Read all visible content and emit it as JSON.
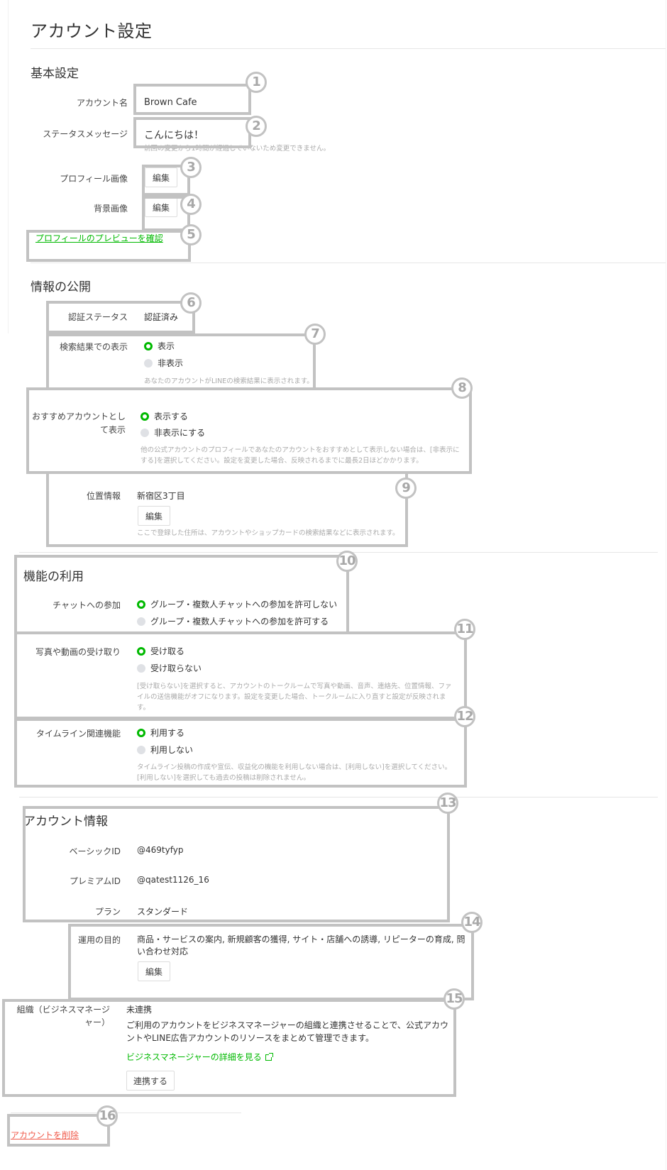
{
  "page": {
    "title": "アカウント設定"
  },
  "basic": {
    "title": "基本設定",
    "account_name_label": "アカウント名",
    "account_name_value": "Brown Cafe",
    "status_label": "ステータスメッセージ",
    "status_value": "こんにちは！",
    "status_help": "前回の変更から1時間が経過していないため変更できません。",
    "profile_image_label": "プロフィール画像",
    "background_image_label": "背景画像",
    "edit_label": "編集",
    "preview_link": "プロフィールのプレビューを確認"
  },
  "disclosure": {
    "title": "情報の公開",
    "verify_label": "認証ステータス",
    "verify_value": "認証済み",
    "search_label": "検索結果での表示",
    "search_options": [
      "表示",
      "非表示"
    ],
    "search_selected": 0,
    "search_help": "あなたのアカウントがLINEの検索結果に表示されます。",
    "recommend_label_1": "おすすめアカウントとし",
    "recommend_label_2": "て表示",
    "recommend_options": [
      "表示する",
      "非表示にする"
    ],
    "recommend_selected": 0,
    "recommend_help_1": "他の公式アカウントのプロフィールであなたのアカウントをおすすめとして表示しない場合は、[非表示に",
    "recommend_help_2": "する]を選択してください。設定を変更した場合、反映されるまでに最長2日ほどかかります。",
    "location_label": "位置情報",
    "location_value": "新宿区3丁目",
    "location_edit": "編集",
    "location_help": "ここで登録した住所は、アカウントやショップカードの検索結果などに表示されます。"
  },
  "features": {
    "title": "機能の利用",
    "chat_label": "チャットへの参加",
    "chat_options": [
      "グループ・複数人チャットへの参加を許可しない",
      "グループ・複数人チャットへの参加を許可する"
    ],
    "chat_selected": 0,
    "media_label": "写真や動画の受け取り",
    "media_options": [
      "受け取る",
      "受け取らない"
    ],
    "media_selected": 0,
    "media_help_1": "[受け取らない]を選択すると、アカウントのトークルームで写真や動画、音声、連絡先、位置情報、ファ",
    "media_help_2": "イルの送信機能がオフになります。設定を変更した場合、トークルームに入り直すと設定が反映されま",
    "media_help_3": "す。",
    "timeline_label": "タイムライン関連機能",
    "timeline_options": [
      "利用する",
      "利用しない"
    ],
    "timeline_selected": 0,
    "timeline_help_1": "タイムライン投稿の作成や宣伝、収益化の機能を利用しない場合は、[利用しない]を選択してください。",
    "timeline_help_2": "[利用しない]を選択しても過去の投稿は削除されません。"
  },
  "account_info": {
    "title": "アカウント情報",
    "basic_id_label": "ベーシックID",
    "basic_id_value": "@469tyfyp",
    "premium_id_label": "プレミアムID",
    "premium_id_value": "@qatest1126_16",
    "plan_label": "プラン",
    "plan_value": "スタンダード",
    "purpose_label": "運用の目的",
    "purpose_value_1": "商品・サービスの案内, 新規顧客の獲得, サイト・店舗への誘導, リピーターの育成, 問",
    "purpose_value_2": "い合わせ対応",
    "purpose_edit": "編集",
    "org_label_1": "組織（ビジネスマネージ",
    "org_label_2": "ャー）",
    "org_status": "未連携",
    "org_desc_1": "ご利用のアカウントをビジネスマネージャーの組織と連携させることで、公式アカウ",
    "org_desc_2": "ントやLINE広告アカウントのリソースをまとめて管理できます。",
    "org_link": "ビジネスマネージャーの詳細を見る",
    "org_button": "連携する"
  },
  "delete_link": "アカウントを削除",
  "annotations": [
    "1",
    "2",
    "3",
    "4",
    "5",
    "6",
    "7",
    "8",
    "9",
    "10",
    "11",
    "12",
    "13",
    "14",
    "15",
    "16"
  ],
  "colors": {
    "accent": "#00b900",
    "danger": "#f05b4b",
    "annotation": "#c2c2c2"
  }
}
